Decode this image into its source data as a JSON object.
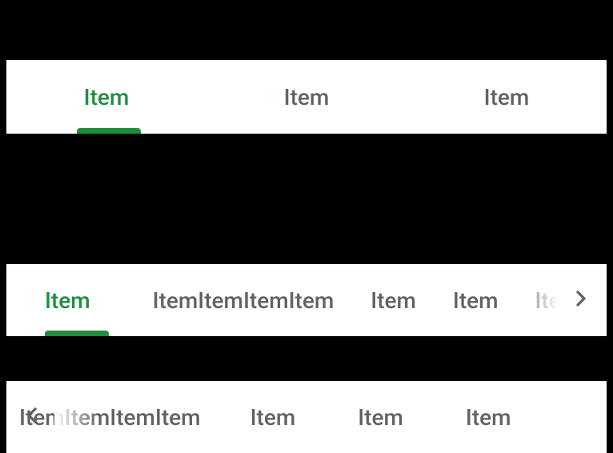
{
  "colors": {
    "accent": "#1e8e3e",
    "text": "#5f6368",
    "arrow": "#5f6368"
  },
  "fixedTabs": {
    "items": [
      {
        "label": "Item"
      },
      {
        "label": "Item"
      },
      {
        "label": "Item"
      }
    ],
    "activeIndex": 0
  },
  "scrollTabsA": {
    "items": [
      {
        "label": "Item"
      },
      {
        "label": "ItemItemItemItem"
      },
      {
        "label": "Item"
      },
      {
        "label": "Item"
      },
      {
        "label": "Item"
      }
    ],
    "activeIndex": 0,
    "showRightArrow": true
  },
  "scrollTabsB": {
    "items": [
      {
        "label": "ItemItemItemItem"
      },
      {
        "label": "Item"
      },
      {
        "label": "Item"
      },
      {
        "label": "Item"
      }
    ],
    "scrollOffset": -60,
    "showLeftArrow": true
  }
}
